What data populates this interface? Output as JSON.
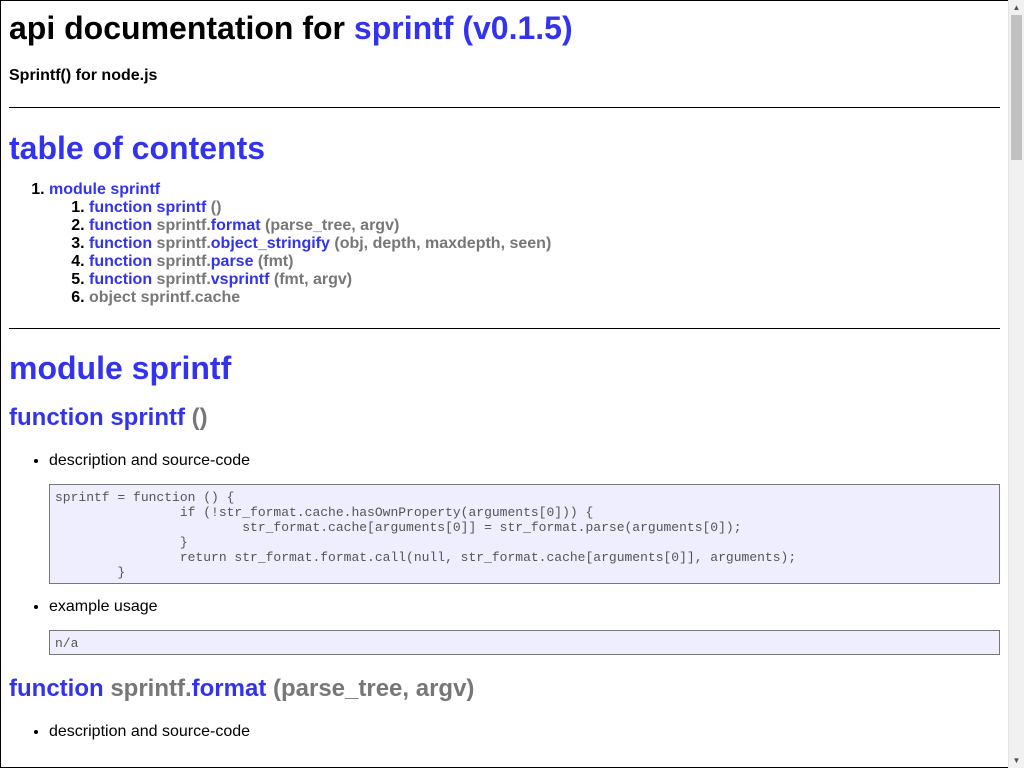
{
  "header": {
    "title_prefix": "api documentation for",
    "title_link": "sprintf (v0.1.5)",
    "subtitle": "Sprintf() for node.js"
  },
  "toc": {
    "heading": "table of contents",
    "module": "module sprintf",
    "items": [
      {
        "kind": "function",
        "prefix": "",
        "name": "sprintf",
        "args": "()"
      },
      {
        "kind": "function",
        "prefix": "sprintf.",
        "name": "format",
        "args": "(parse_tree, argv)"
      },
      {
        "kind": "function",
        "prefix": "sprintf.",
        "name": "object_stringify",
        "args": "(obj, depth, maxdepth, seen)"
      },
      {
        "kind": "function",
        "prefix": "sprintf.",
        "name": "parse",
        "args": "(fmt)"
      },
      {
        "kind": "function",
        "prefix": "sprintf.",
        "name": "vsprintf",
        "args": "(fmt, argv)"
      },
      {
        "kind": "object",
        "text": "object sprintf.cache"
      }
    ]
  },
  "module_section": {
    "heading": "module sprintf",
    "fn1": {
      "kind": "function",
      "name": "sprintf",
      "args": "()",
      "desc_label": "description and source-code",
      "code": "sprintf = function () {\n                if (!str_format.cache.hasOwnProperty(arguments[0])) {\n                        str_format.cache[arguments[0]] = str_format.parse(arguments[0]);\n                }\n                return str_format.format.call(null, str_format.cache[arguments[0]], arguments);\n        }",
      "example_label": "example usage",
      "example": "n/a"
    },
    "fn2": {
      "kind": "function",
      "prefix": "sprintf.",
      "name": "format",
      "args": "(parse_tree, argv)",
      "desc_label": "description and source-code"
    }
  },
  "colors": {
    "link": "#3333ee",
    "muted": "#777777",
    "code_bg": "#eeeeff",
    "code_text": "#555555"
  },
  "icons": {
    "scroll_up": "▲",
    "scroll_down": "▼"
  }
}
